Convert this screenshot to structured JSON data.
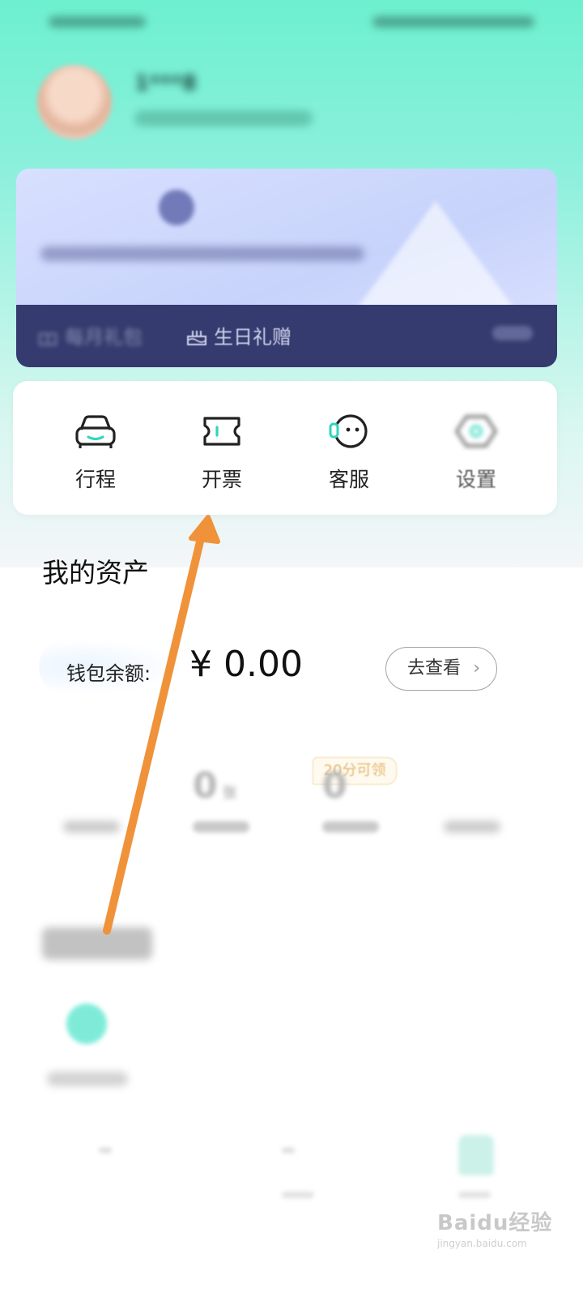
{
  "profile": {
    "name": "1***8"
  },
  "member": {
    "title": "",
    "perks": [
      "每月礼包",
      "生日礼赠"
    ]
  },
  "shortcuts": [
    {
      "label": "行程",
      "icon": "car-icon"
    },
    {
      "label": "开票",
      "icon": "ticket-icon"
    },
    {
      "label": "客服",
      "icon": "customer-service-icon"
    },
    {
      "label": "设置",
      "icon": "settings-hex-icon"
    }
  ],
  "assets": {
    "title": "我的资产",
    "wallet_label": "钱包余额:",
    "wallet_value": "¥ 0.00",
    "view_button": "去查看",
    "promo_badge": "20分可领",
    "stats": [
      {
        "value": "",
        "unit": ""
      },
      {
        "value": "0",
        "unit": "张"
      },
      {
        "value": "0",
        "unit": ""
      },
      {
        "value": "",
        "unit": ""
      }
    ]
  },
  "watermark": {
    "text": "Baidu经验",
    "sub": "jingyan.baidu.com"
  },
  "colors": {
    "accent": "#5ee7cf",
    "arrow": "#f0923a",
    "member_bar": "#353b6e"
  }
}
